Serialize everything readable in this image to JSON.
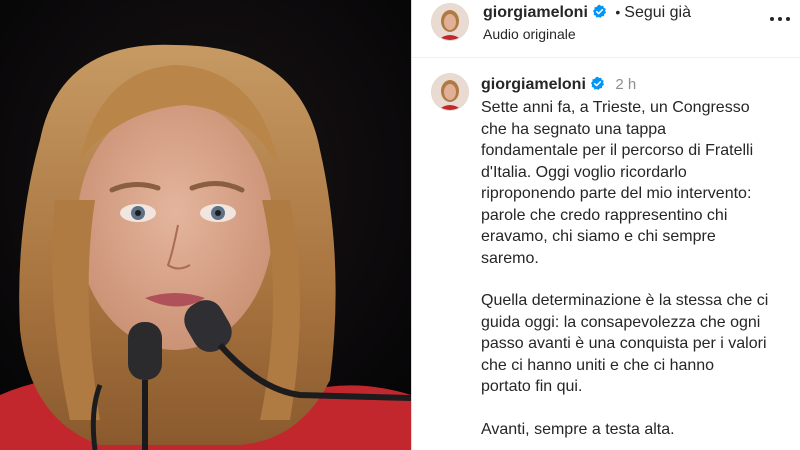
{
  "post": {
    "username": "giorgiameloni",
    "follow_label": "Segui già",
    "audio_label": "Audio originale",
    "time_ago": "2 h",
    "caption": [
      "Sette anni fa, a Trieste, un Congresso\nche ha segnato una tappa\nfondamentale per il percorso di Fratelli\nd'Italia. Oggi voglio ricordarlo\nriproponendo parte del mio intervento:\nparole che credo rappresentino chi\neravamo, chi siamo e chi sempre\nsaremo.",
      "Quella determinazione è la stessa che ci\nguida oggi: la consapevolezza che ogni\npasso avanti è una conquista per i valori\nche ci hanno uniti e che ci hanno\nportato fin qui.",
      "Avanti, sempre a testa alta."
    ]
  },
  "icons": {
    "verified": "verified-badge-icon",
    "more": "more-options-icon"
  },
  "colors": {
    "verified_blue": "#0095f6",
    "text": "#262626",
    "muted": "#8e8e8e"
  }
}
